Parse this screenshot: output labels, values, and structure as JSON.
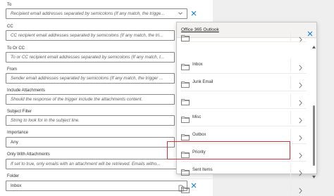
{
  "form": {
    "fields": [
      {
        "label": "To",
        "value": "Recipient email addresses separated by semicolons (If any match, the trigge...",
        "placeholder": true,
        "dropdown": true,
        "clear": true
      },
      {
        "label": "CC",
        "value": "CC recipient email addresses separated by semicolons (If any match, the tri..."
      },
      {
        "label": "To Or CC",
        "value": "To or CC recipient email addresses separated by semicolons (If any match, t..."
      },
      {
        "label": "From",
        "value": "Sender email addresses separated by semicolons (If any match, the trigger ..."
      },
      {
        "label": "Include Attachments",
        "value": "Should the response of the trigger include the attachments content."
      },
      {
        "label": "Subject Filter",
        "value": "String to look for in the subject line."
      },
      {
        "label": "Importance",
        "value": "Any"
      },
      {
        "label": "Only With Attachments",
        "value": "If set to true, only emails with an attachment will be retrieved. Emails witho..."
      },
      {
        "label": "Folder",
        "value": "Inbox"
      }
    ]
  },
  "popup": {
    "title": "Office 365 Outlook",
    "items": [
      {
        "label": ""
      },
      {
        "label": "Inbox"
      },
      {
        "label": "Junk Email"
      },
      {
        "label": ""
      },
      {
        "label": "Misc"
      },
      {
        "label": "Outbox"
      },
      {
        "label": "Priority"
      },
      {
        "label": "Sent Items"
      },
      {
        "label": ""
      }
    ],
    "highlight_index": 7,
    "icons": {
      "folder": "folder-icon",
      "chevron": "chevron-right-icon",
      "close": "close-icon"
    }
  },
  "colors": {
    "highlight": "#d13438",
    "accent": "#0078d4",
    "border": "#8a8886"
  }
}
